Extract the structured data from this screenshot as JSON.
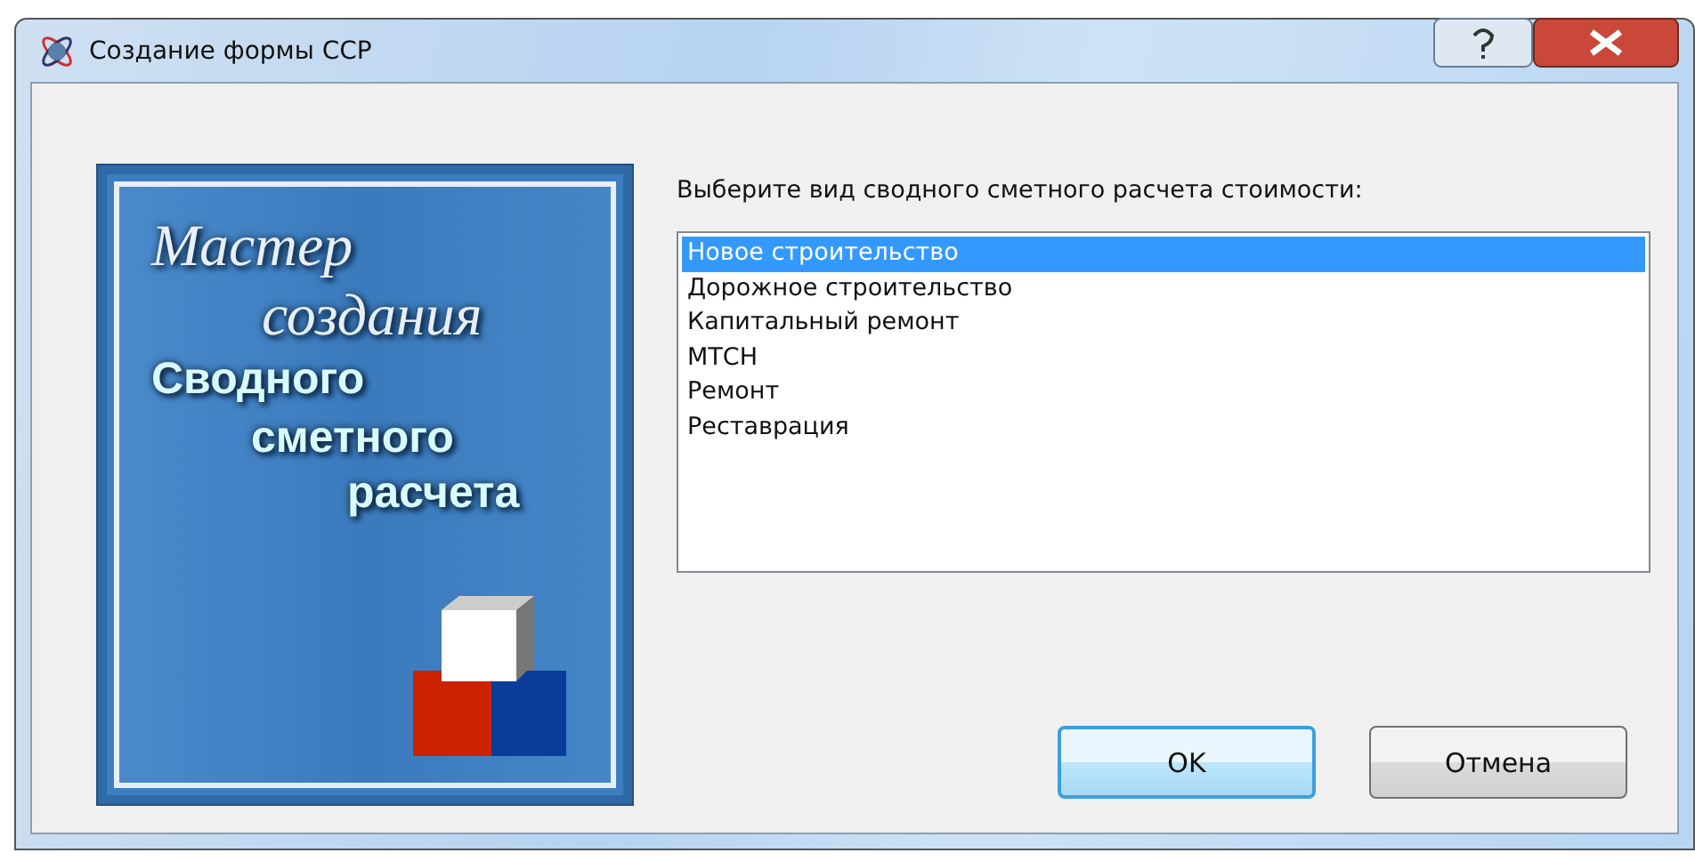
{
  "window": {
    "title": "Создание формы ССР"
  },
  "banner": {
    "lines": [
      {
        "text": "Мастер",
        "kind": "script"
      },
      {
        "text": "создания",
        "kind": "script"
      },
      {
        "text": "Сводного",
        "kind": "block"
      },
      {
        "text": "сметного",
        "kind": "block"
      },
      {
        "text": "расчета",
        "kind": "block"
      }
    ]
  },
  "prompt": "Выберите вид сводного сметного расчета стоимости:",
  "options": [
    {
      "label": "Новое строительство",
      "selected": true
    },
    {
      "label": "Дорожное строительство",
      "selected": false
    },
    {
      "label": "Капитальный ремонт",
      "selected": false
    },
    {
      "label": "МТСН",
      "selected": false
    },
    {
      "label": "Ремонт",
      "selected": false
    },
    {
      "label": "Реставрация",
      "selected": false
    }
  ],
  "buttons": [
    {
      "label": "OK",
      "default": true
    },
    {
      "label": "Отмена",
      "default": false
    }
  ]
}
